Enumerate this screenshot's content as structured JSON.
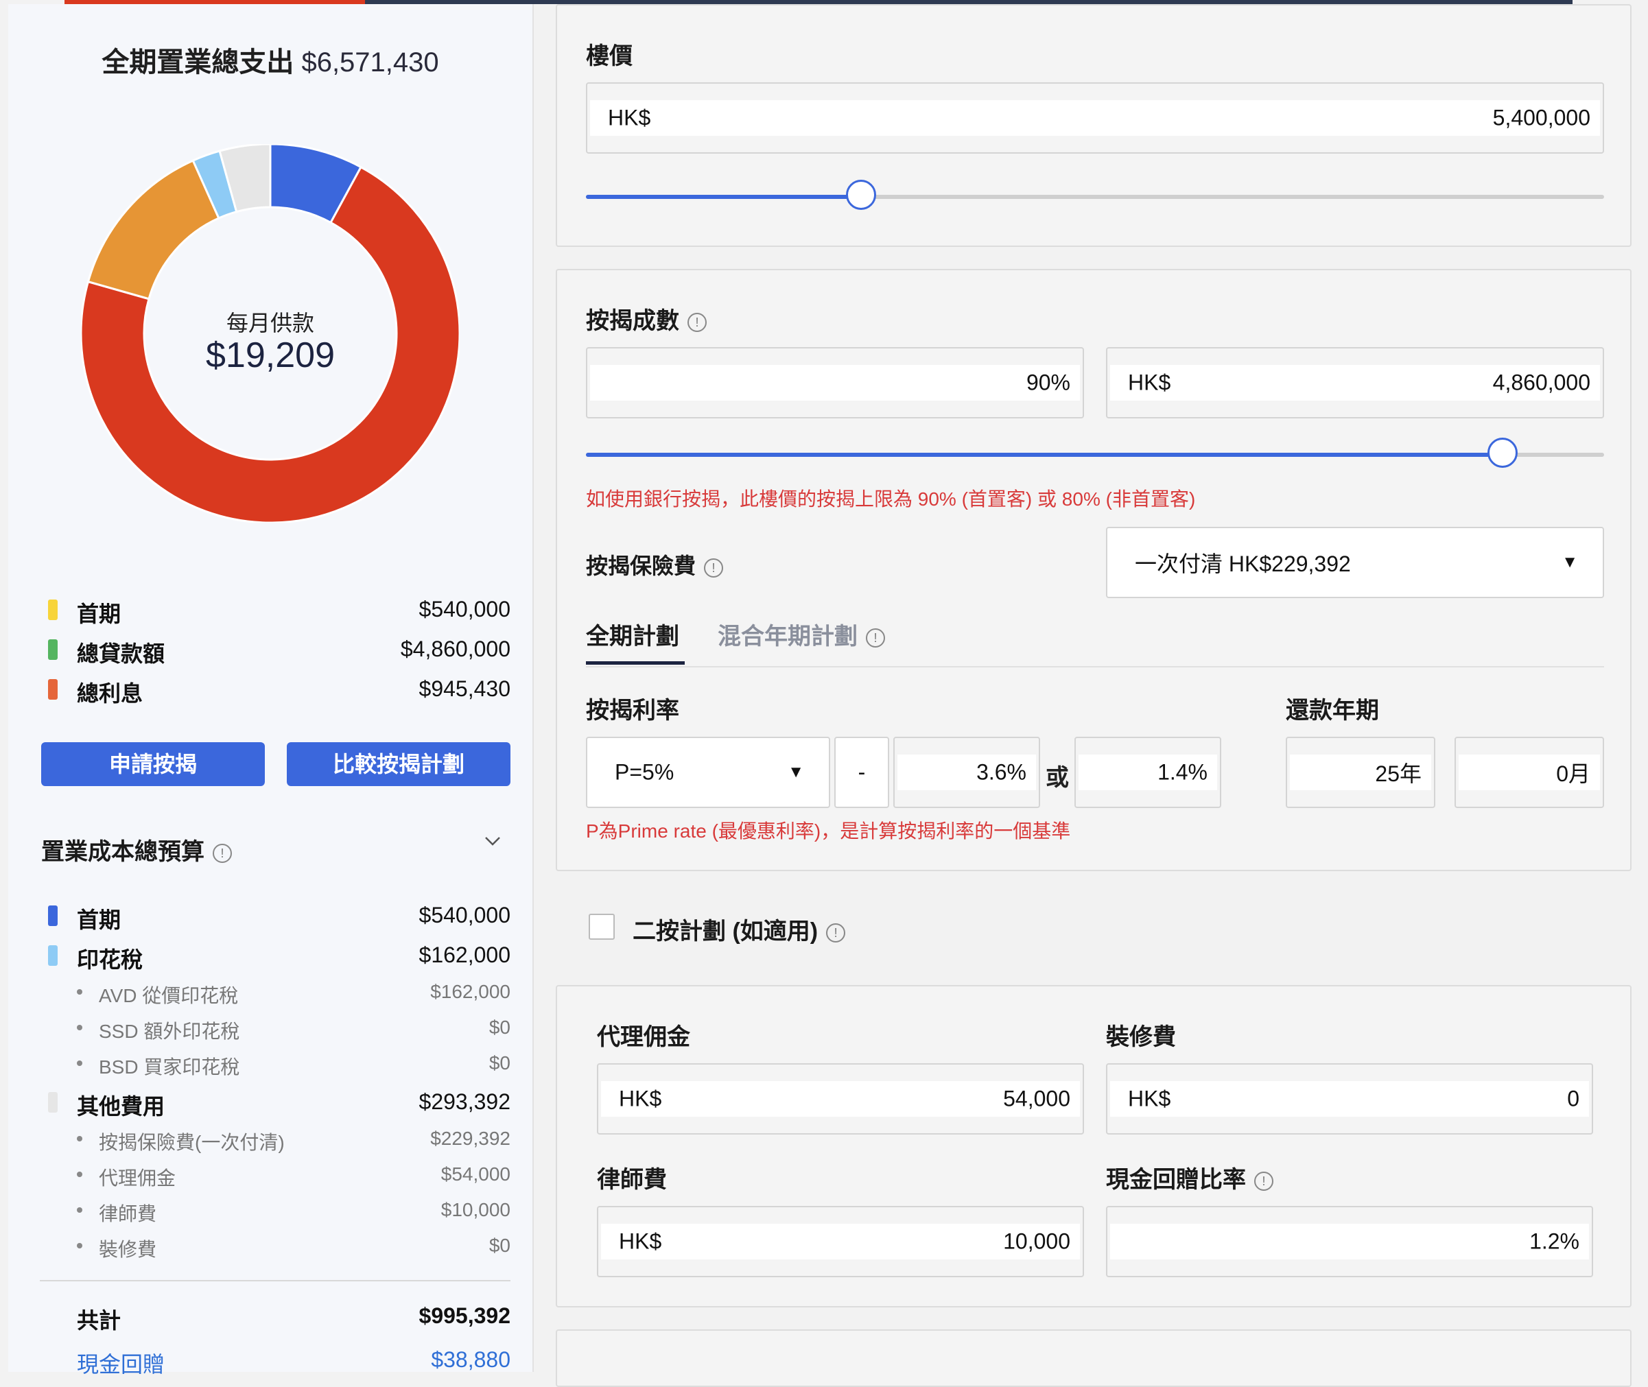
{
  "colors": {
    "accent": "#3b67dc",
    "red": "#d9391f",
    "orange": "#e69535",
    "light_blue": "#8ecbf5",
    "grey": "#e6e6e6",
    "yellow": "#f7d43a",
    "green": "#55b560",
    "interest": "#e5663a",
    "note_red": "#d83a3a",
    "link_blue": "#2f6fd6"
  },
  "summary": {
    "title": "全期置業總支出",
    "total": "$6,571,430",
    "center_label": "每月供款",
    "center_value": "$19,209"
  },
  "donut_segments": [
    {
      "value": 540000,
      "color": "#3b67dc"
    },
    {
      "value": 4860000,
      "color": "#d9391f"
    },
    {
      "value": 945430,
      "color": "#e69535"
    },
    {
      "value": 162000,
      "color": "#8ecbf5"
    },
    {
      "value": 293392,
      "color": "#e6e6e6"
    }
  ],
  "legend": [
    {
      "label": "首期",
      "value": "$540,000",
      "color": "#f7d43a"
    },
    {
      "label": "總貸款額",
      "value": "$4,860,000",
      "color": "#55b560"
    },
    {
      "label": "總利息",
      "value": "$945,430",
      "color": "#e5663a"
    }
  ],
  "buttons": {
    "apply": "申請按揭",
    "compare": "比較按揭計劃"
  },
  "budget": {
    "title": "置業成本總預算",
    "info": "!",
    "items": {
      "down": {
        "label": "首期",
        "value": "$540,000",
        "color": "#3b67dc"
      },
      "stamp": {
        "label": "印花稅",
        "value": "$162,000",
        "color": "#8ecbf5"
      },
      "avd": {
        "label": "AVD 從價印花稅",
        "value": "$162,000"
      },
      "ssd": {
        "label": "SSD 額外印花稅",
        "value": "$0"
      },
      "bsd": {
        "label": "BSD 買家印花稅",
        "value": "$0"
      },
      "other": {
        "label": "其他費用",
        "value": "$293,392",
        "color": "#e6e6e6"
      },
      "insurance": {
        "label": "按揭保險費(一次付清)",
        "value": "$229,392"
      },
      "agent": {
        "label": "代理佣金",
        "value": "$54,000"
      },
      "lawyer": {
        "label": "律師費",
        "value": "$10,000"
      },
      "renovation": {
        "label": "裝修費",
        "value": "$0"
      }
    },
    "total": {
      "label": "共計",
      "value": "$995,392"
    },
    "cashback": {
      "label": "現金回贈",
      "value": "$38,880"
    }
  },
  "price": {
    "label": "樓價",
    "prefix": "HK$",
    "value": "5,400,000",
    "slider_fraction": 0.27
  },
  "mortgage": {
    "label": "按揭成數",
    "info": "!",
    "percent": "90%",
    "prefix": "HK$",
    "amount": "4,860,000",
    "slider_fraction": 0.9,
    "note": "如使用銀行按揭，此樓價的按揭上限為 90% (首置客) 或 80% (非首置客)",
    "insurance_label": "按揭保險費",
    "insurance_value": "一次付清 HK$229,392",
    "arrow": "▼",
    "tabs": [
      "全期計劃",
      "混合年期計劃"
    ],
    "rate_label": "按揭利率",
    "term_label": "還款年期",
    "prime": "P=5%",
    "dash": "-",
    "rate_a": "3.6%",
    "or": "或",
    "rate_b": "1.4%",
    "years": "25年",
    "months": "0月",
    "prime_note": "P為Prime rate (最優惠利率)，是計算按揭利率的一個基準"
  },
  "second_mortgage": {
    "label": "二按計劃 (如適用)",
    "info": "!"
  },
  "fees": {
    "agent_label": "代理佣金",
    "agent_prefix": "HK$",
    "agent_value": "54,000",
    "renovation_label": "裝修費",
    "renovation_prefix": "HK$",
    "renovation_value": "0",
    "lawyer_label": "律師費",
    "lawyer_prefix": "HK$",
    "lawyer_value": "10,000",
    "cashback_label": "現金回贈比率",
    "cashback_value": "1.2%"
  }
}
